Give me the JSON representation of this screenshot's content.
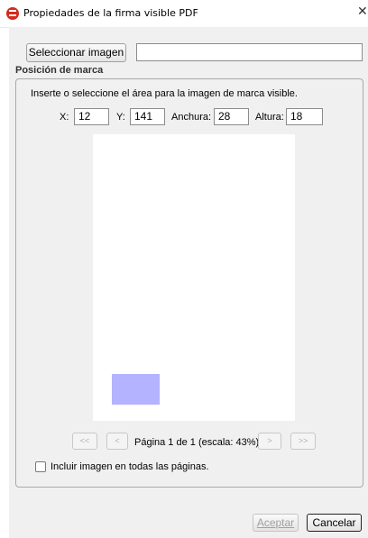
{
  "window": {
    "title": "Propiedades de la firma visible PDF",
    "close_glyph": "✕"
  },
  "toolbar": {
    "select_image_label": "Seleccionar imagen",
    "image_path_value": ""
  },
  "position": {
    "section_label": "Posición de marca",
    "instruction": "Inserte o seleccione el área para la imagen de marca visible.",
    "x_label": "X:",
    "x_value": "12",
    "y_label": "Y:",
    "y_value": "141",
    "width_label": "Anchura:",
    "width_value": "28",
    "height_label": "Altura:",
    "height_value": "18"
  },
  "pager": {
    "first": "<<",
    "prev": "<",
    "label": "Página 1 de 1 (escala: 43%)",
    "next": ">",
    "last": ">>"
  },
  "options": {
    "all_pages_label": "Incluir imagen en todas las páginas.",
    "all_pages_checked": false
  },
  "footer": {
    "accept_label": "Aceptar",
    "cancel_label": "Cancelar"
  },
  "colors": {
    "marker": "#b3b3ff",
    "app_icon": "#d52b1e"
  }
}
